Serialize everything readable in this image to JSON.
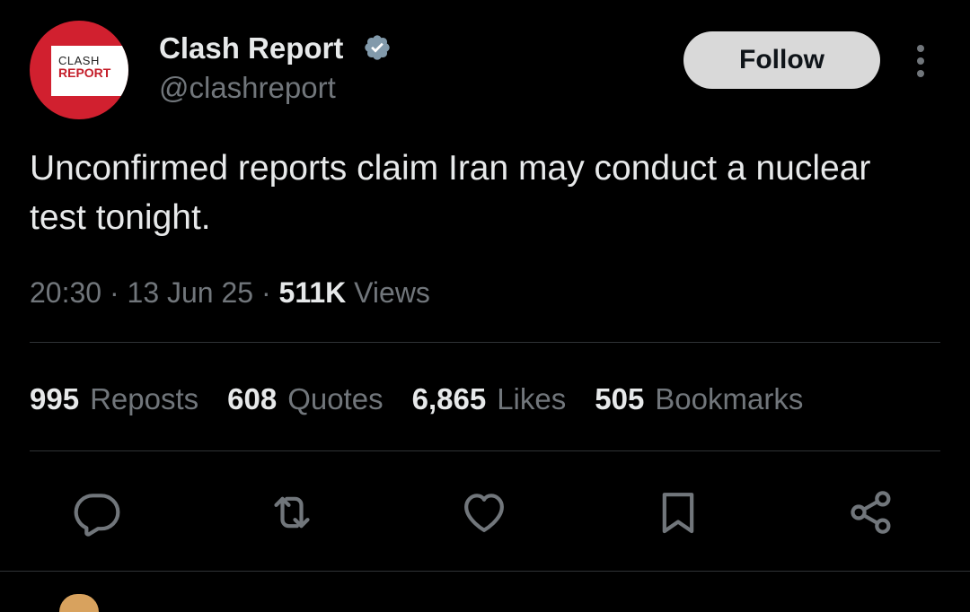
{
  "tweet": {
    "author": {
      "display_name": "Clash Report",
      "handle": "@clashreport",
      "verified": true,
      "avatar": {
        "line1": "CLASH",
        "line2": "REPORT",
        "colors": {
          "background": "#d1202f",
          "card": "#ffffff",
          "accent": "#c41e2a"
        }
      }
    },
    "follow_label": "Follow",
    "more_icon": "more-vertical-icon",
    "text": "Unconfirmed reports claim Iran may conduct a nuclear test tonight.",
    "meta": {
      "time": "20:30",
      "separator": "·",
      "date": "13 Jun 25",
      "views_count": "511K",
      "views_label": "Views"
    },
    "stats": [
      {
        "count": "995",
        "label": "Reposts"
      },
      {
        "count": "608",
        "label": "Quotes"
      },
      {
        "count": "6,865",
        "label": "Likes"
      },
      {
        "count": "505",
        "label": "Bookmarks"
      }
    ],
    "actions": [
      {
        "icon": "reply-icon"
      },
      {
        "icon": "repost-icon"
      },
      {
        "icon": "like-heart-icon"
      },
      {
        "icon": "bookmark-icon"
      },
      {
        "icon": "share-icon"
      }
    ]
  },
  "theme": {
    "background": "#000000",
    "text_primary": "#e7e9ea",
    "text_secondary": "#71767b",
    "divider": "#2f3336",
    "verified_badge": "#829aab",
    "follow_button_bg": "#d9d9d9"
  }
}
